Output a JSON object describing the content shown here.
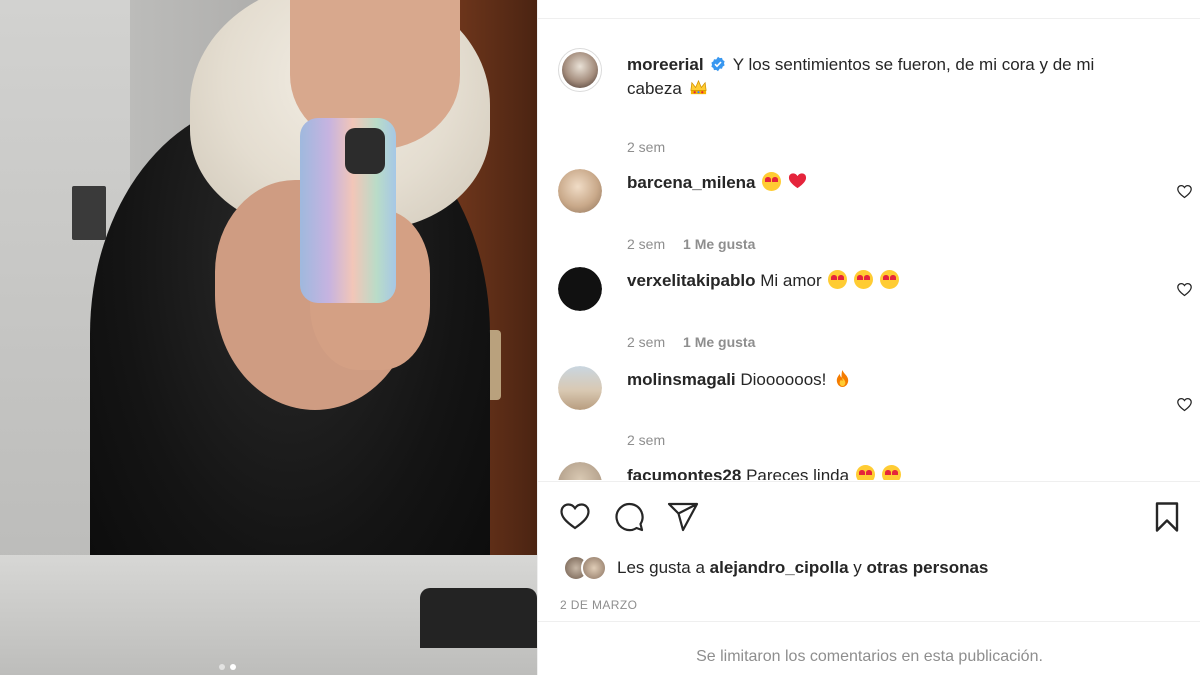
{
  "post": {
    "author": "moreerial",
    "caption": "Y los sentimientos se fueron, de mi cora y de mi cabeza",
    "caption_emoji": "crown-emoji",
    "time": "2 sem",
    "verified_color": "#3897f0"
  },
  "comments": [
    {
      "user": "barcena_milena",
      "text": "",
      "emojis": [
        "heart-eyes-emoji",
        "red-heart-emoji"
      ],
      "time": "2 sem",
      "likes": "1 Me gusta",
      "avatar_color": "#c9a98a"
    },
    {
      "user": "verxelitakipablo",
      "text": "Mi amor",
      "emojis": [
        "heart-eyes-emoji",
        "heart-eyes-emoji",
        "heart-eyes-emoji"
      ],
      "time": "2 sem",
      "likes": "1 Me gusta",
      "avatar_color": "#111111"
    },
    {
      "user": "molinsmagali",
      "text": "Dioooooos!",
      "emojis": [
        "fire-emoji"
      ],
      "time": "2 sem",
      "likes": "",
      "avatar_color": "#d9c9b3"
    },
    {
      "user": "facumontes28",
      "text": "Pareces linda",
      "emojis": [
        "smiling-emoji",
        "smiling-emoji"
      ],
      "time": "",
      "likes": "",
      "avatar_color": "#b8a590"
    }
  ],
  "likes_summary": {
    "prefix": "Les gusta a",
    "user": "alejandro_cipolla",
    "connector": "y",
    "others": "otras personas"
  },
  "date": "2 DE MARZO",
  "comments_limited": "Se limitaron los comentarios en esta publicación.",
  "carousel": {
    "count": 2,
    "active_index": 1
  },
  "colors": {
    "text": "#262626",
    "muted": "#8e8e8e",
    "divider": "#efefef",
    "heart_red": "#e5243b",
    "emoji_yellow": "#ffcc33"
  }
}
